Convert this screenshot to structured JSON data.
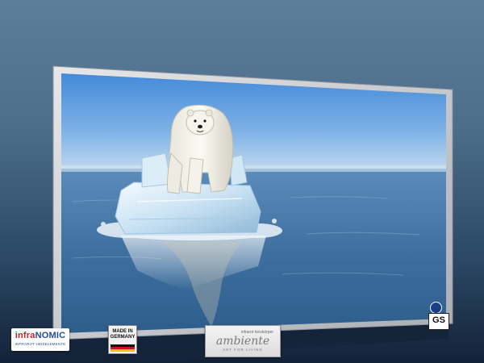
{
  "badges": {
    "infranomic": {
      "brand_part1": "infra",
      "brand_part2": "NOMIC",
      "tagline": "INFRAROT HEIZELEMENTE"
    },
    "made_in_germany": {
      "line1": "MADE IN",
      "line2": "GERMANY"
    },
    "ambiente": {
      "top_text": "infrarot heizkörper",
      "brand": "ambiente",
      "tagline": "ART FOR LIVING"
    },
    "gs_mark": {
      "label": "GS"
    }
  },
  "colors": {
    "background_top": "#5d7e9a",
    "background_bottom": "#142238",
    "frame": "#c6c8ca",
    "sky": "#4f8fd6",
    "sea": "#3f6f9c",
    "infra_red": "#c8242b",
    "nomic_blue": "#1f4d92"
  }
}
